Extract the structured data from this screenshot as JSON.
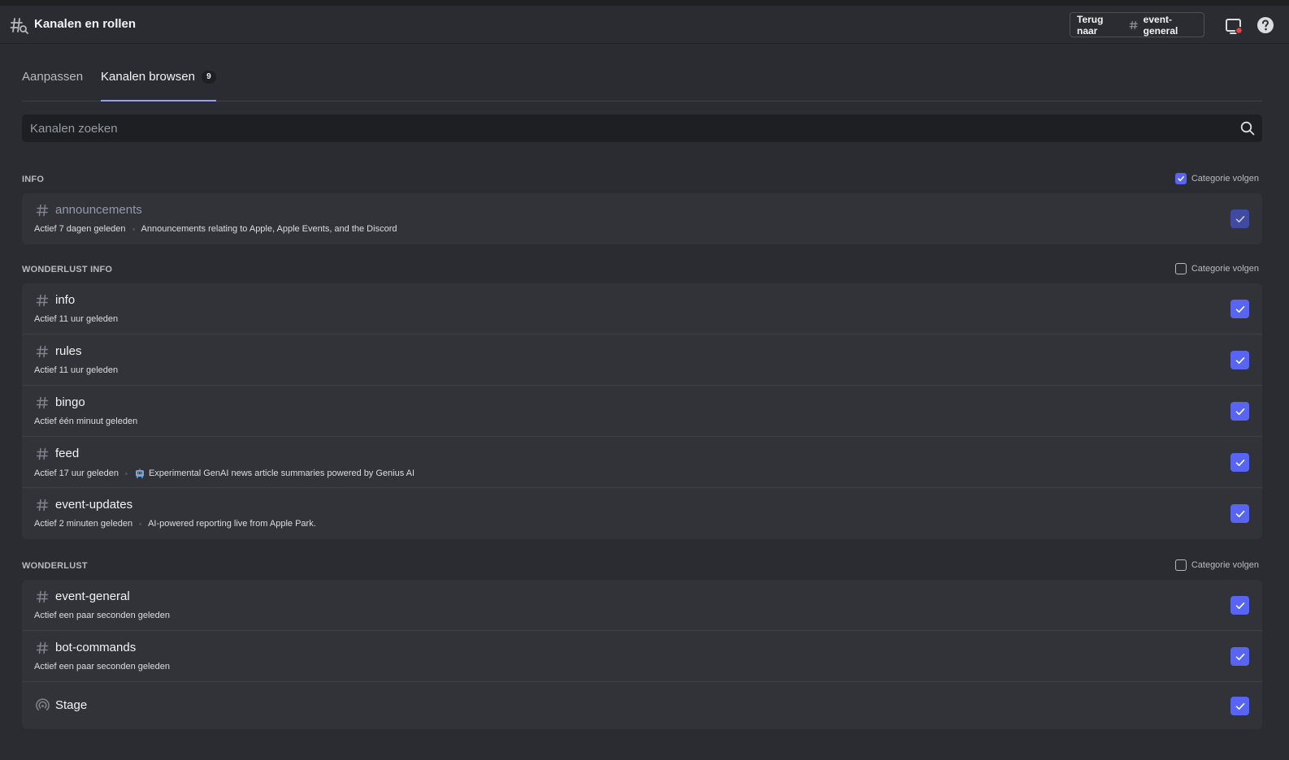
{
  "header": {
    "title": "Kanalen en rollen",
    "back_prefix": "Terug naar",
    "back_channel": "event-general"
  },
  "tabs": [
    {
      "label": "Aanpassen"
    },
    {
      "label": "Kanalen browsen",
      "badge": "9"
    }
  ],
  "search": {
    "placeholder": "Kanalen zoeken"
  },
  "follow_label": "Categorie volgen",
  "categories": [
    {
      "name": "INFO",
      "followed": true,
      "channels": [
        {
          "name": "announcements",
          "activity": "Actief 7 dagen geleden",
          "description": "Announcements relating to Apple, Apple Events, and the Discord",
          "checked": true
        }
      ]
    },
    {
      "name": "WONDERLUST INFO",
      "followed": false,
      "channels": [
        {
          "name": "info",
          "activity": "Actief 11 uur geleden",
          "checked": true
        },
        {
          "name": "rules",
          "activity": "Actief 11 uur geleden",
          "checked": true
        },
        {
          "name": "bingo",
          "activity": "Actief één minuut geleden",
          "checked": true
        },
        {
          "name": "feed",
          "activity": "Actief 17 uur geleden",
          "description": "Experimental GenAI news article summaries powered by Genius AI",
          "emoji": "robot-emoji",
          "checked": true
        },
        {
          "name": "event-updates",
          "activity": "Actief 2 minuten geleden",
          "description": "AI-powered reporting live from Apple Park.",
          "checked": true
        }
      ]
    },
    {
      "name": "WONDERLUST",
      "followed": false,
      "channels": [
        {
          "name": "event-general",
          "activity": "Actief een paar seconden geleden",
          "checked": true
        },
        {
          "name": "bot-commands",
          "activity": "Actief een paar seconden geleden",
          "checked": true
        },
        {
          "name": "Stage",
          "type": "stage",
          "checked": true
        }
      ]
    }
  ],
  "colors": {
    "accent": "#5865f2",
    "background": "#2b2c31",
    "panel": "#313338"
  }
}
